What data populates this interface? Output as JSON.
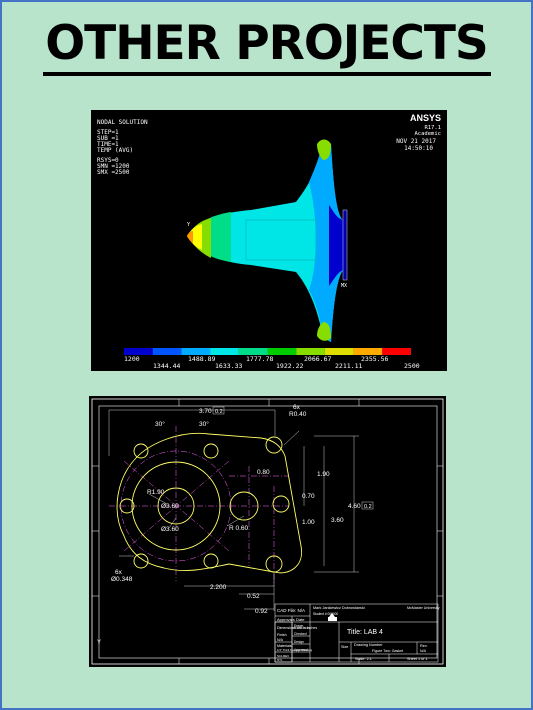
{
  "slide": {
    "title": "OTHER PROJECTS",
    "background": "#b7e4cb",
    "border_color": "#4472c4"
  },
  "ansys": {
    "header": [
      "NODAL SOLUTION",
      "STEP=1",
      "SUB =1",
      "TIME=1",
      "TEMP     (AVG)",
      "RSYS=0",
      "SMN =1200",
      "SMX =2500"
    ],
    "brand": "ANSYS",
    "version": "R17.1",
    "edition": "Academic",
    "date": "NOV 21 2017",
    "time": "14:50:10",
    "max_marker": "MX",
    "triad_label": "Y",
    "legend_top": [
      "1200",
      "1488.89",
      "1777.78",
      "2066.67",
      "2355.56"
    ],
    "legend_bottom": [
      "1344.44",
      "1633.33",
      "1922.22",
      "2211.11",
      "2500"
    ],
    "colors": [
      "#0000cc",
      "#0055ff",
      "#00aaff",
      "#00e5e5",
      "#00dd88",
      "#00cc00",
      "#88dd00",
      "#dddd00",
      "#ffaa00",
      "#ff0000"
    ]
  },
  "drawing": {
    "dims": {
      "top_width": "3.70",
      "top_tol": "0.2",
      "hole_note_count": "6x",
      "hole_note_radius": "R0.40",
      "angle_left": "30°",
      "angle_right": "30°",
      "r_left": "R1.90",
      "dia_center": "Ø3.60",
      "dia_inner": "Ø3.60",
      "r_small": "R 0.60",
      "d_080": "0.80",
      "d_190": "1.90",
      "d_070": "0.70",
      "d_100": "1.00",
      "d_360": "3.60",
      "d_460": "4.60",
      "d_460_tol": "0.2",
      "small_hole_count": "6x",
      "small_hole_dia": "Ø0.348",
      "d_2200": "2.200",
      "d_052": "0.52",
      "d_092": "0.92"
    },
    "title_block": {
      "cad_file": "CAD File: N/A",
      "author": "Mark Jankiewicz Dobrowlanski",
      "student": "Student # 000000",
      "university": "McMaster University",
      "approvals": "Approvals",
      "date": "Date",
      "sub_rows": [
        "Drawn",
        "Checked",
        "Design",
        "Approved"
      ],
      "dimensions_note": "Dimensions are in inches",
      "finish_label": "Finish",
      "finish_value": "N/A",
      "materials_label": "Materials",
      "materials_value": "1/4\" Thick Nominal Sheeting",
      "title": "Title: LAB 4",
      "size": "Size",
      "drawing_number_label": "Drawing Number",
      "drawing_number": "Figure Two: Gasket",
      "rev_label": "Rev.",
      "rev_value": "N/A",
      "scale": "Scale: 2:1",
      "sheet": "Sheet 1 of 1",
      "col_labels": [
        "SCL",
        "REV",
        "NTL"
      ]
    },
    "axis_label": "Y"
  }
}
